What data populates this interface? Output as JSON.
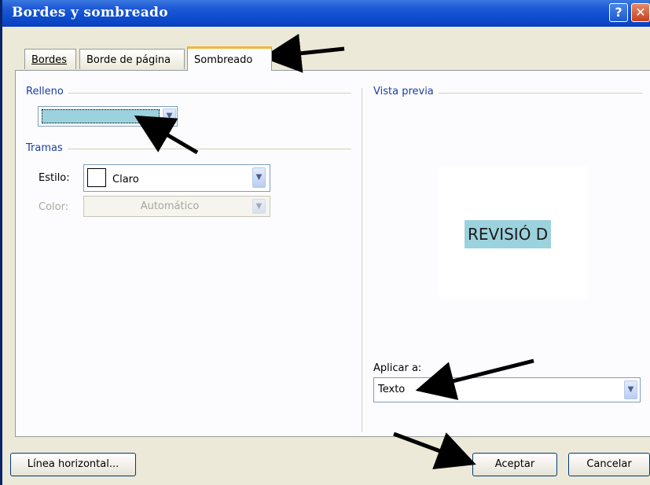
{
  "window": {
    "title": "Bordes y sombreado",
    "help": "?",
    "close": "✕"
  },
  "tabs": [
    {
      "label": "Bordes"
    },
    {
      "label": "Borde de página"
    },
    {
      "label": "Sombreado"
    }
  ],
  "relleno": {
    "label": "Relleno",
    "color": "#9cd2dd"
  },
  "tramas": {
    "label": "Tramas",
    "style_label": "Estilo:",
    "style_value": "Claro",
    "color_label": "Color:",
    "color_value": "Automático"
  },
  "preview": {
    "label": "Vista previa",
    "sample_text": "REVISIÓ D"
  },
  "apply": {
    "label": "Aplicar a:",
    "value": "Texto"
  },
  "buttons": {
    "horizontal_line": "Línea horizontal...",
    "ok": "Aceptar",
    "cancel": "Cancelar"
  },
  "colors": {
    "title_bar": "#0e4fcf",
    "active_tab_accent": "#f5b33b",
    "shading": "#9cd2dd"
  }
}
